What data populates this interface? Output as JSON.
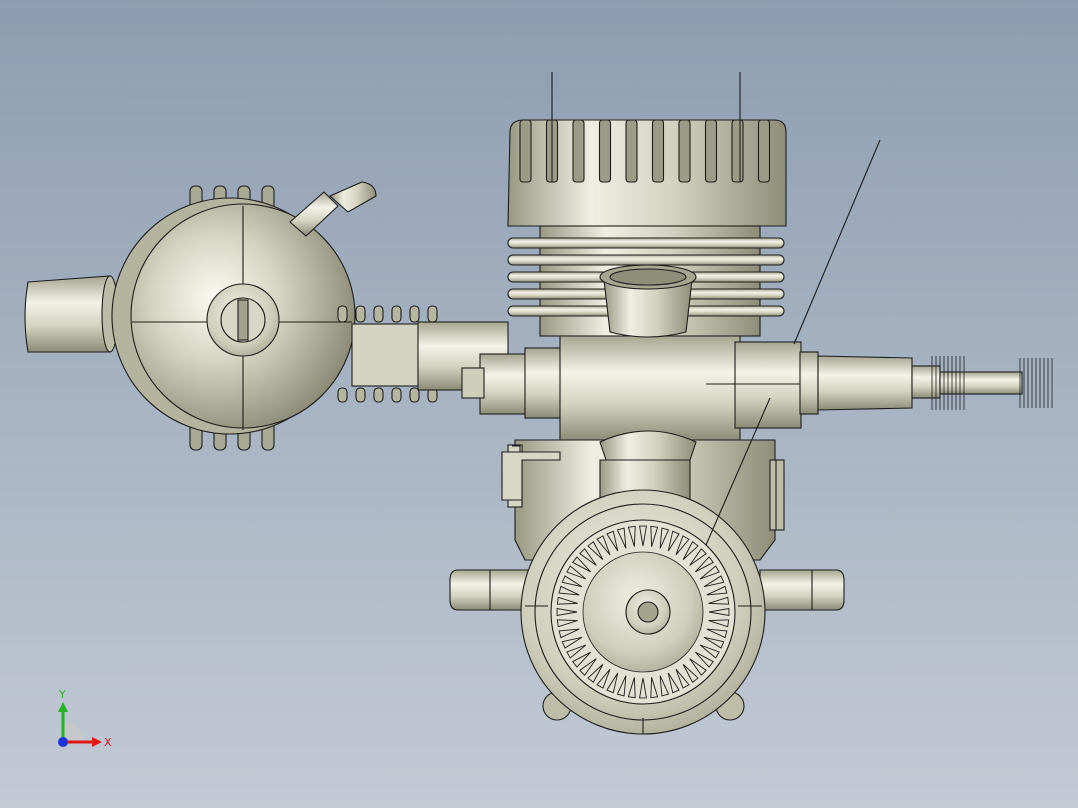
{
  "viewport": {
    "background_top": "#8d9db1",
    "background_bottom": "#c2cad4"
  },
  "model": {
    "metal_light": "#f1f0e6",
    "metal_mid": "#c9c8b3",
    "metal_dark": "#8e8d77",
    "edge_color": "#1d1d1d"
  },
  "triad": {
    "x_label": "X",
    "y_label": "Y",
    "x_color": "#e01818",
    "y_color": "#22b422",
    "z_color": "#1c33d8"
  }
}
